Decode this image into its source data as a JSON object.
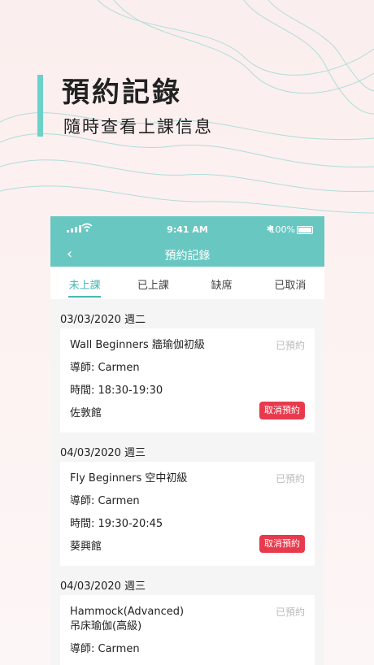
{
  "hero": {
    "title": "預約記錄",
    "subtitle": "隨時查看上課信息"
  },
  "colors": {
    "accent": "#68c7c1",
    "tab_active": "#4ab9b2",
    "cancel": "#e83a4c",
    "hero_bar": "#6cd1c9"
  },
  "statusbar": {
    "time": "9:41 AM",
    "battery": "100%",
    "bluetooth": "✱"
  },
  "navbar": {
    "back_icon": "‹",
    "title": "預約記錄"
  },
  "tabs": [
    {
      "label": "未上課",
      "active": true
    },
    {
      "label": "已上課",
      "active": false
    },
    {
      "label": "缺席",
      "active": false
    },
    {
      "label": "已取消",
      "active": false
    }
  ],
  "bookings": [
    {
      "date": "03/03/2020 週二",
      "title": "Wall Beginners 牆瑜伽初級",
      "status": "已預約",
      "teacher": "導師: Carmen",
      "time": "時間: 18:30-19:30",
      "venue": "佐敦館",
      "cancel_label": "取消預約"
    },
    {
      "date": "04/03/2020 週三",
      "title": "Fly Beginners 空中初級",
      "status": "已預約",
      "teacher": "導師: Carmen",
      "time": "時間: 19:30-20:45",
      "venue": "葵興館",
      "cancel_label": "取消預約"
    },
    {
      "date": "04/03/2020 週三",
      "title": "Hammock(Advanced) 吊床瑜伽(高級)",
      "status": "已預約",
      "teacher": "導師: Carmen"
    }
  ]
}
